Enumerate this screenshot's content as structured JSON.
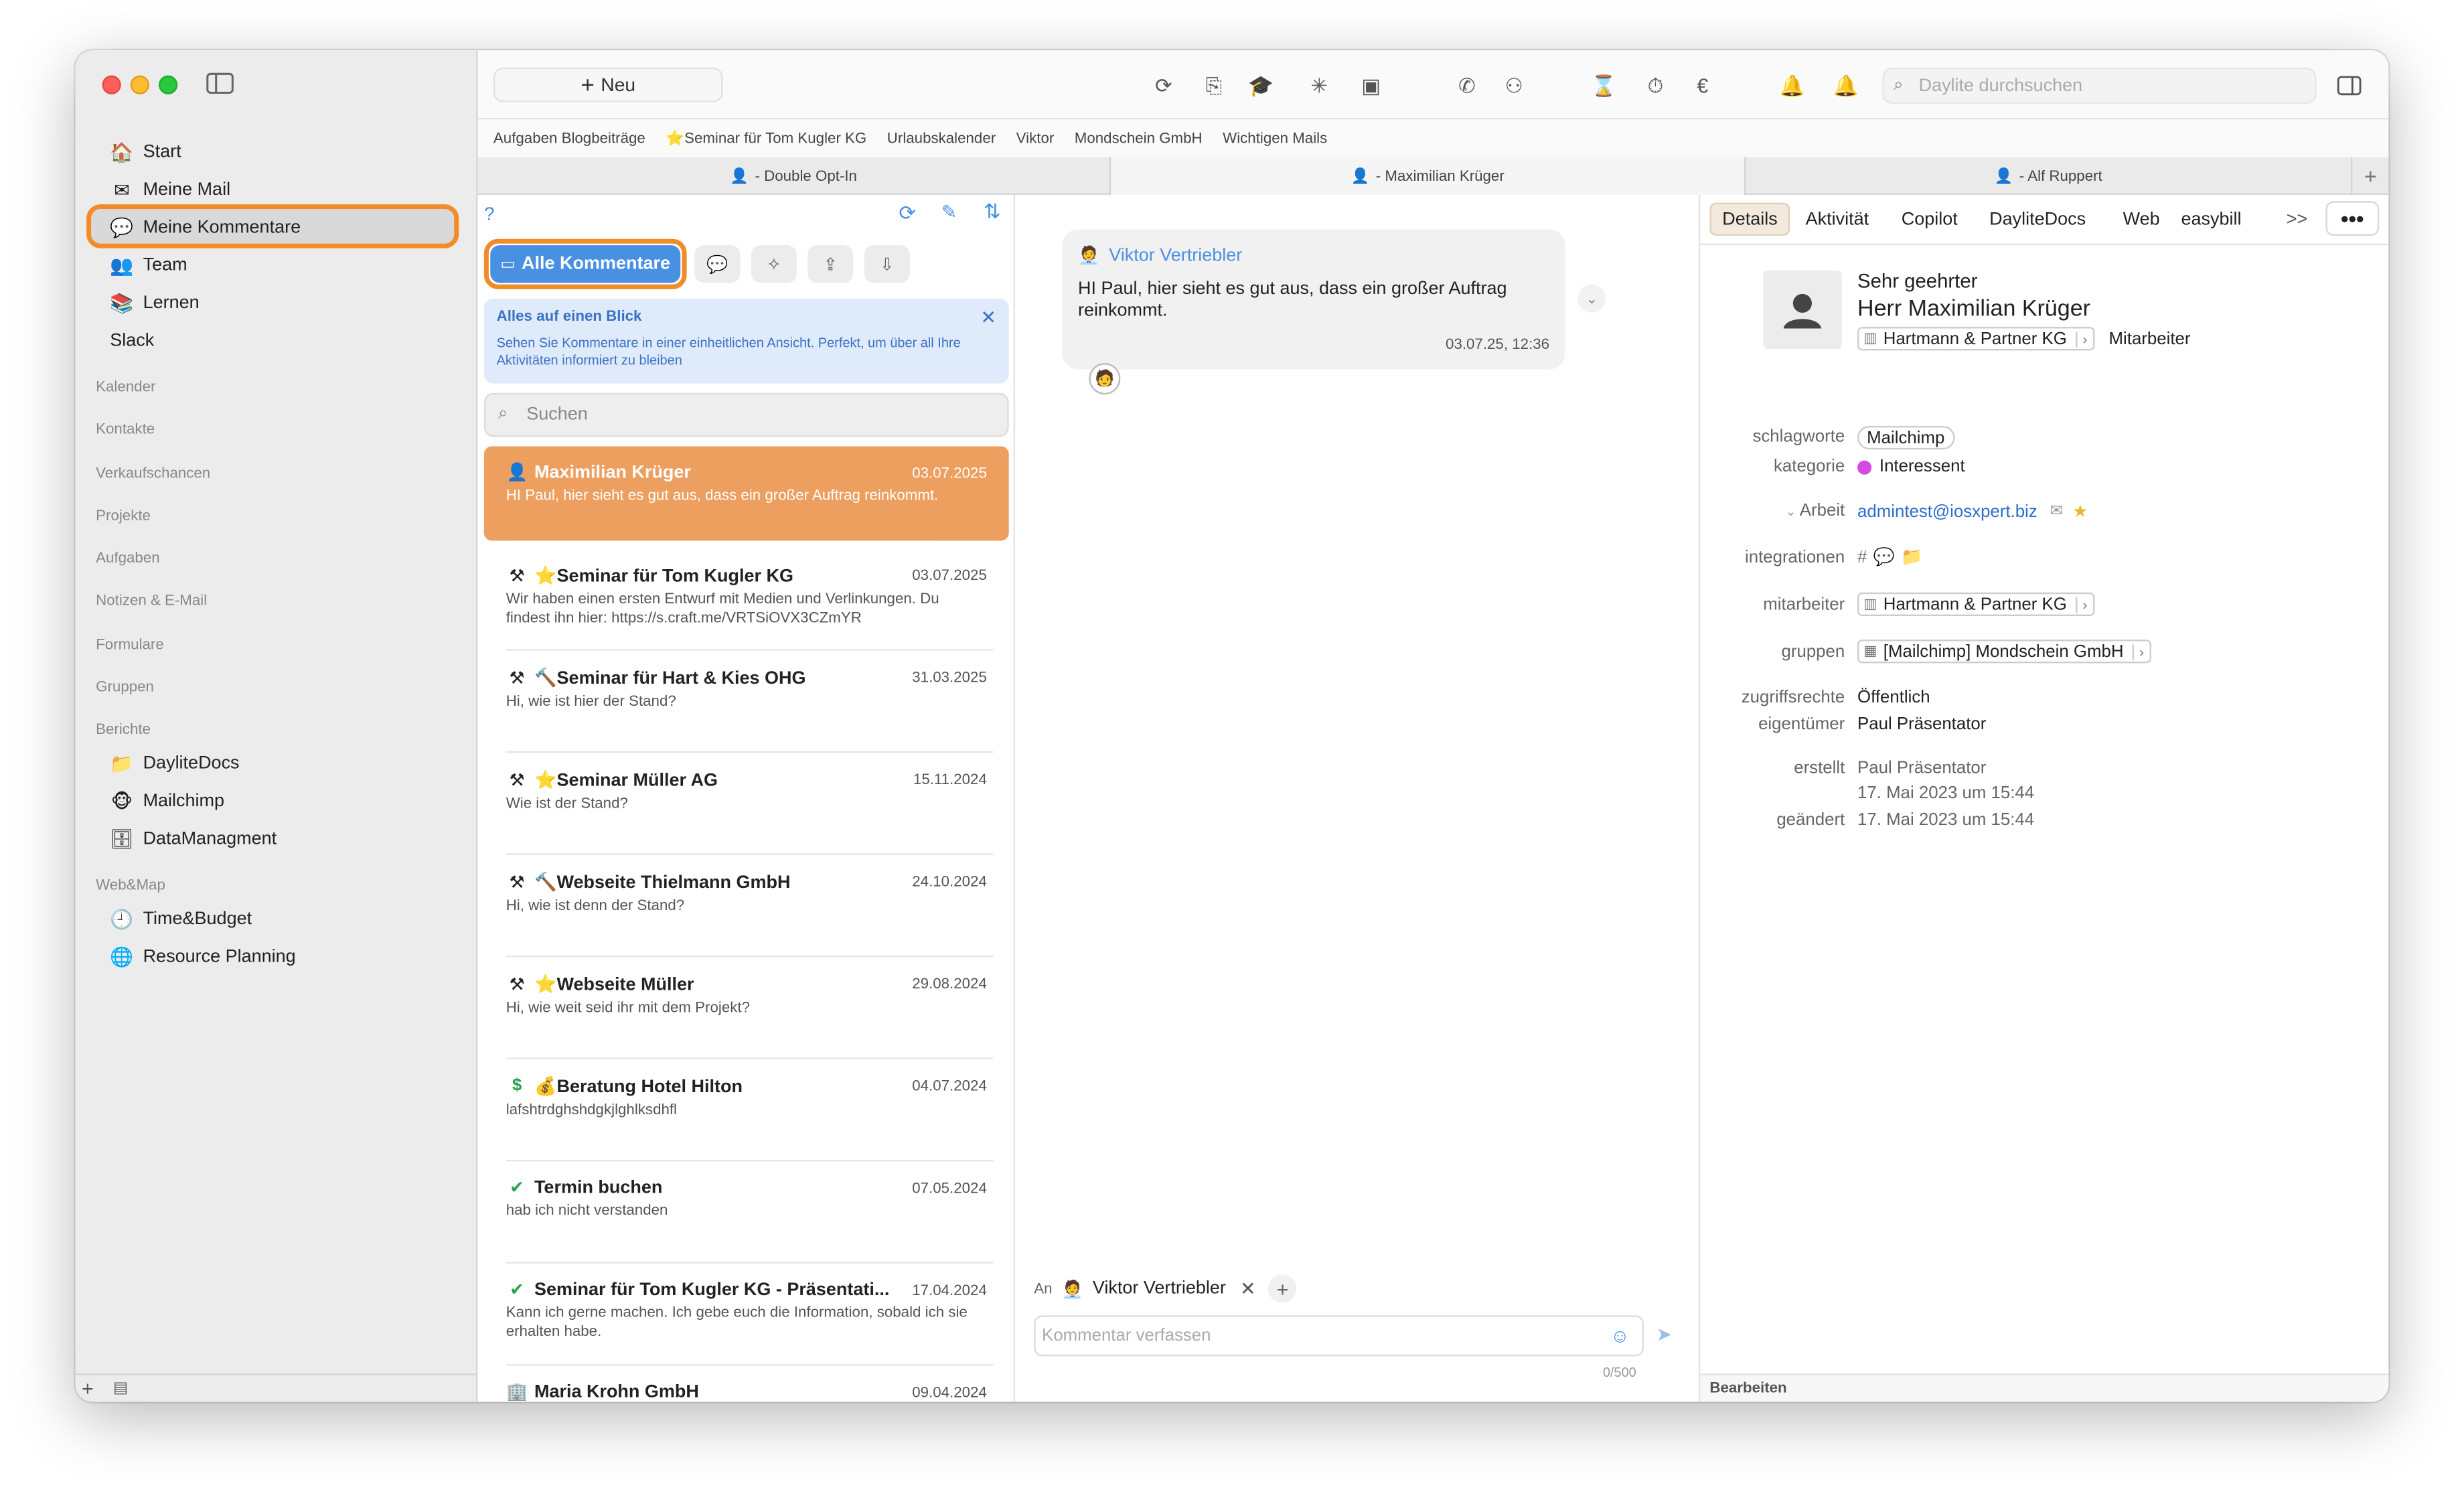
{
  "sidebar": {
    "items": [
      {
        "label": "Start",
        "icon": "house-icon"
      },
      {
        "label": "Meine Mail",
        "icon": "mail-icon"
      },
      {
        "label": "Meine Kommentare",
        "icon": "comments-icon"
      },
      {
        "label": "Team",
        "icon": "team-icon"
      },
      {
        "label": "Lernen",
        "icon": "books-icon"
      },
      {
        "label": "Slack",
        "icon": ""
      }
    ],
    "sections": [
      "Kalender",
      "Kontakte",
      "Verkaufschancen",
      "Projekte",
      "Aufgaben",
      "Notizen & E-Mail",
      "Formulare",
      "Gruppen",
      "Berichte",
      "Web&Map"
    ],
    "berichte_items": [
      {
        "label": "DayliteDocs",
        "icon": "folder-icon"
      },
      {
        "label": "Mailchimp",
        "icon": "mailchimp-icon"
      },
      {
        "label": "DataManagment",
        "icon": "database-icon"
      }
    ],
    "webmap_items": [
      {
        "label": "Time&Budget",
        "icon": "clock-icon"
      },
      {
        "label": "Resource Planning",
        "icon": "globe-icon"
      }
    ]
  },
  "toolbar": {
    "new_label": "Neu",
    "search_placeholder": "Daylite durchsuchen"
  },
  "favorites": [
    "Aufgaben Blogbeiträge",
    "⭐Seminar für Tom Kugler KG",
    "Urlaubskalender",
    "Viktor",
    "Mondschein GmbH",
    "Wichtigen Mails"
  ],
  "tabs": [
    "- Double Opt-In",
    "- Maximilian Krüger",
    "- Alf Ruppert"
  ],
  "list": {
    "help": "?",
    "filter_active": "Alle Kommentare",
    "info_title": "Alles auf einen Blick",
    "info_text": "Sehen Sie Kommentare in einer einheitlichen Ansicht. Perfekt, um über all Ihre Aktivitäten informiert zu bleiben",
    "search_placeholder": "Suchen",
    "items": [
      {
        "title": "Maximilian Krüger",
        "date": "03.07.2025",
        "snippet": "HI Paul, hier sieht es gut aus, dass ein großer Auftrag reinkommt.",
        "icon": "person-icon"
      },
      {
        "title": "⭐Seminar für Tom Kugler KG",
        "date": "03.07.2025",
        "snippet": "Wir haben einen ersten Entwurf mit Medien und Verlinkungen. Du findest ihn hier: https://s.craft.me/VRTSiOVX3CZmYR",
        "icon": "project-icon"
      },
      {
        "title": "🔨Seminar für Hart & Kies OHG",
        "date": "31.03.2025",
        "snippet": "Hi, wie ist hier der Stand?",
        "icon": "project-icon"
      },
      {
        "title": "⭐Seminar Müller AG",
        "date": "15.11.2024",
        "snippet": "Wie ist der Stand?",
        "icon": "project-icon"
      },
      {
        "title": "🔨Webseite Thielmann GmbH",
        "date": "24.10.2024",
        "snippet": "Hi, wie ist denn der Stand?",
        "icon": "project-icon"
      },
      {
        "title": "⭐Webseite Müller",
        "date": "29.08.2024",
        "snippet": "Hi, wie weit seid ihr mit dem Projekt?",
        "icon": "project-icon"
      },
      {
        "title": "💰Beratung Hotel Hilton",
        "date": "04.07.2024",
        "snippet": "lafshtrdghshdgkjlghlksdhfl",
        "icon": "dollar-icon"
      },
      {
        "title": "Termin buchen",
        "date": "07.05.2024",
        "snippet": "hab ich nicht verstanden",
        "icon": "check-icon"
      },
      {
        "title": "Seminar für Tom Kugler KG - Präsentati...",
        "date": "17.04.2024",
        "snippet": "Kann ich gerne machen. Ich gebe euch die Information, sobald ich sie erhalten habe.",
        "icon": "check-icon"
      },
      {
        "title": "Maria Krohn GmbH",
        "date": "09.04.2024",
        "snippet": "",
        "icon": "building-icon"
      }
    ]
  },
  "chat": {
    "author": "Viktor Vertriebler",
    "message": "HI Paul, hier sieht es gut aus, dass ein großer Auftrag reinkommt.",
    "time": "03.07.25, 12:36",
    "to_label": "An",
    "recipient": "Viktor Vertriebler",
    "compose_placeholder": "Kommentar verfassen",
    "counter": "0/500"
  },
  "detail": {
    "tabs": [
      "Details",
      "Aktivität",
      "Copilot",
      "DayliteDocs",
      "Web",
      "easybill"
    ],
    "overflow": ">>",
    "more": "•••",
    "salutation": "Sehr geehrter",
    "name": "Herr Maximilian Krüger",
    "company": "Hartmann & Partner KG",
    "role": "Mitarbeiter",
    "fields": {
      "schlagworte_label": "schlagworte",
      "schlagworte": "Mailchimp",
      "kategorie_label": "kategorie",
      "kategorie": "Interessent",
      "arbeit_label": "Arbeit",
      "email": "admintest@iosxpert.biz",
      "integrationen_label": "integrationen",
      "mitarbeiter_label": "mitarbeiter",
      "mitarbeiter": "Hartmann & Partner KG",
      "gruppen_label": "gruppen",
      "gruppen": "[Mailchimp] Mondschein GmbH",
      "zugriff_label": "zugriffsrechte",
      "zugriff": "Öffentlich",
      "eigentuemer_label": "eigentümer",
      "eigentuemer": "Paul Präsentator",
      "erstellt_label": "erstellt",
      "erstellt_by": "Paul Präsentator",
      "erstellt_date": "17. Mai 2023 um 15:44",
      "geaendert_label": "geändert",
      "geaendert_date": "17. Mai 2023 um 15:44"
    },
    "edit_label": "Bearbeiten"
  },
  "colors": {
    "accent": "#4a90e2",
    "highlight": "#f28c28",
    "selected_item": "#ec9f5f",
    "kategorie_dot": "#d74ae0"
  }
}
